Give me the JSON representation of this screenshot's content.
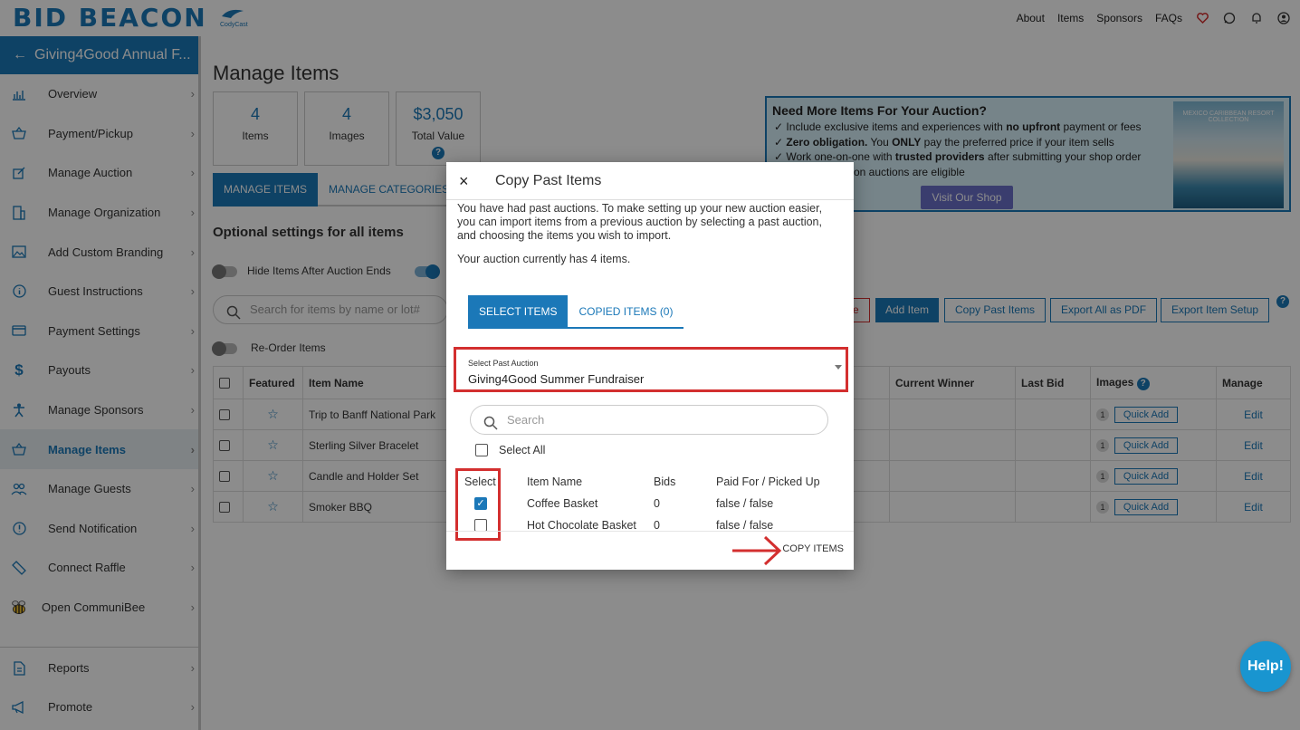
{
  "brand": {
    "logo_text": "BID BEACON",
    "sub_logo_text": "CodyCast"
  },
  "topnav": {
    "about": "About",
    "items": "Items",
    "sponsors": "Sponsors",
    "faqs": "FAQs"
  },
  "sidebar": {
    "event_title": "Giving4Good Annual F...",
    "items": [
      {
        "label": "Overview",
        "icon": "chart-icon"
      },
      {
        "label": "Payment/Pickup",
        "icon": "basket-icon"
      },
      {
        "label": "Manage Auction",
        "icon": "edit-icon"
      },
      {
        "label": "Manage Organization",
        "icon": "building-icon"
      },
      {
        "label": "Add Custom Branding",
        "icon": "image-icon"
      },
      {
        "label": "Guest Instructions",
        "icon": "info-icon"
      },
      {
        "label": "Payment Settings",
        "icon": "card-icon"
      },
      {
        "label": "Payouts",
        "icon": "dollar-icon"
      },
      {
        "label": "Manage Sponsors",
        "icon": "person-icon"
      },
      {
        "label": "Manage Items",
        "icon": "basket-icon"
      },
      {
        "label": "Manage Guests",
        "icon": "users-icon"
      },
      {
        "label": "Send Notification",
        "icon": "alert-icon"
      },
      {
        "label": "Connect Raffle",
        "icon": "ticket-icon"
      },
      {
        "label": "Open CommuniBee",
        "icon": "bee-icon"
      }
    ],
    "bottom_items": [
      {
        "label": "Reports",
        "icon": "doc-icon"
      },
      {
        "label": "Promote",
        "icon": "megaphone-icon"
      }
    ]
  },
  "main": {
    "title": "Manage Items",
    "stats": [
      {
        "num": "4",
        "label": "Items"
      },
      {
        "num": "4",
        "label": "Images"
      },
      {
        "num": "$3,050",
        "label": "Total Value"
      }
    ],
    "tabs": [
      "MANAGE ITEMS",
      "MANAGE CATEGORIES"
    ],
    "optional_title": "Optional settings for all items",
    "hide_items_label": "Hide Items After Auction Ends",
    "reorder_label": "Re-Order Items",
    "search_placeholder": "Search for items by name or lot#",
    "buttons": {
      "partial": "e",
      "add_item": "Add Item",
      "copy_past": "Copy Past Items",
      "export_pdf": "Export All as PDF",
      "export_setup": "Export Item Setup"
    },
    "table": {
      "headers": [
        "Featured",
        "Item Name",
        "Current Winner",
        "Last Bid",
        "Images",
        "Manage"
      ],
      "rows": [
        {
          "name": "Trip to Banff National Park",
          "images": "1",
          "quick": "Quick Add",
          "edit": "Edit"
        },
        {
          "name": "Sterling Silver Bracelet",
          "images": "1",
          "quick": "Quick Add",
          "edit": "Edit"
        },
        {
          "name": "Candle and Holder Set",
          "images": "1",
          "quick": "Quick Add",
          "edit": "Edit"
        },
        {
          "name": "Smoker BBQ",
          "images": "1",
          "quick": "Quick Add",
          "edit": "Edit"
        }
      ]
    }
  },
  "promo": {
    "title": "Need More Items For Your Auction?",
    "line1_pre": "✓ Include exclusive items and experiences with ",
    "line1_bold": "no upfront",
    "line1_post": " payment or fees",
    "line2_bold": "✓ Zero obligation.",
    "line2_mid": " You ",
    "line2_bold2": "ONLY",
    "line2_post": " pay the preferred price if your item sells",
    "line3_pre": "✓ Work one-on-one with ",
    "line3_bold": "trusted providers",
    "line3_post": " after submitting your shop order",
    "line4": "on auctions are eligible",
    "shop_button": "Visit Our Shop",
    "image_caption": "MEXICO CARIBBEAN RESORT COLLECTION"
  },
  "modal": {
    "close": "×",
    "title": "Copy Past Items",
    "intro": "You have had past auctions. To make setting up your new auction easier, you can import items from a previous auction by selecting a past auction, and choosing the items you wish to import.",
    "count_text": "Your auction currently has 4 items.",
    "tabs": [
      "SELECT ITEMS",
      "COPIED ITEMS (0)"
    ],
    "select_label": "Select Past Auction",
    "select_value": "Giving4Good Summer Fundraiser",
    "search_placeholder": "Search",
    "select_all": "Select All",
    "columns": [
      "Select",
      "Item Name",
      "Bids",
      "Paid For / Picked Up"
    ],
    "rows": [
      {
        "checked": true,
        "name": "Coffee Basket",
        "bids": "0",
        "paid": "false / false"
      },
      {
        "checked": false,
        "name": "Hot Chocolate Basket",
        "bids": "0",
        "paid": "false / false"
      }
    ],
    "copy_button": "COPY ITEMS"
  },
  "help_button": "Help!",
  "colors": {
    "brand": "#1b78b8",
    "highlight": "#d32f2f"
  }
}
